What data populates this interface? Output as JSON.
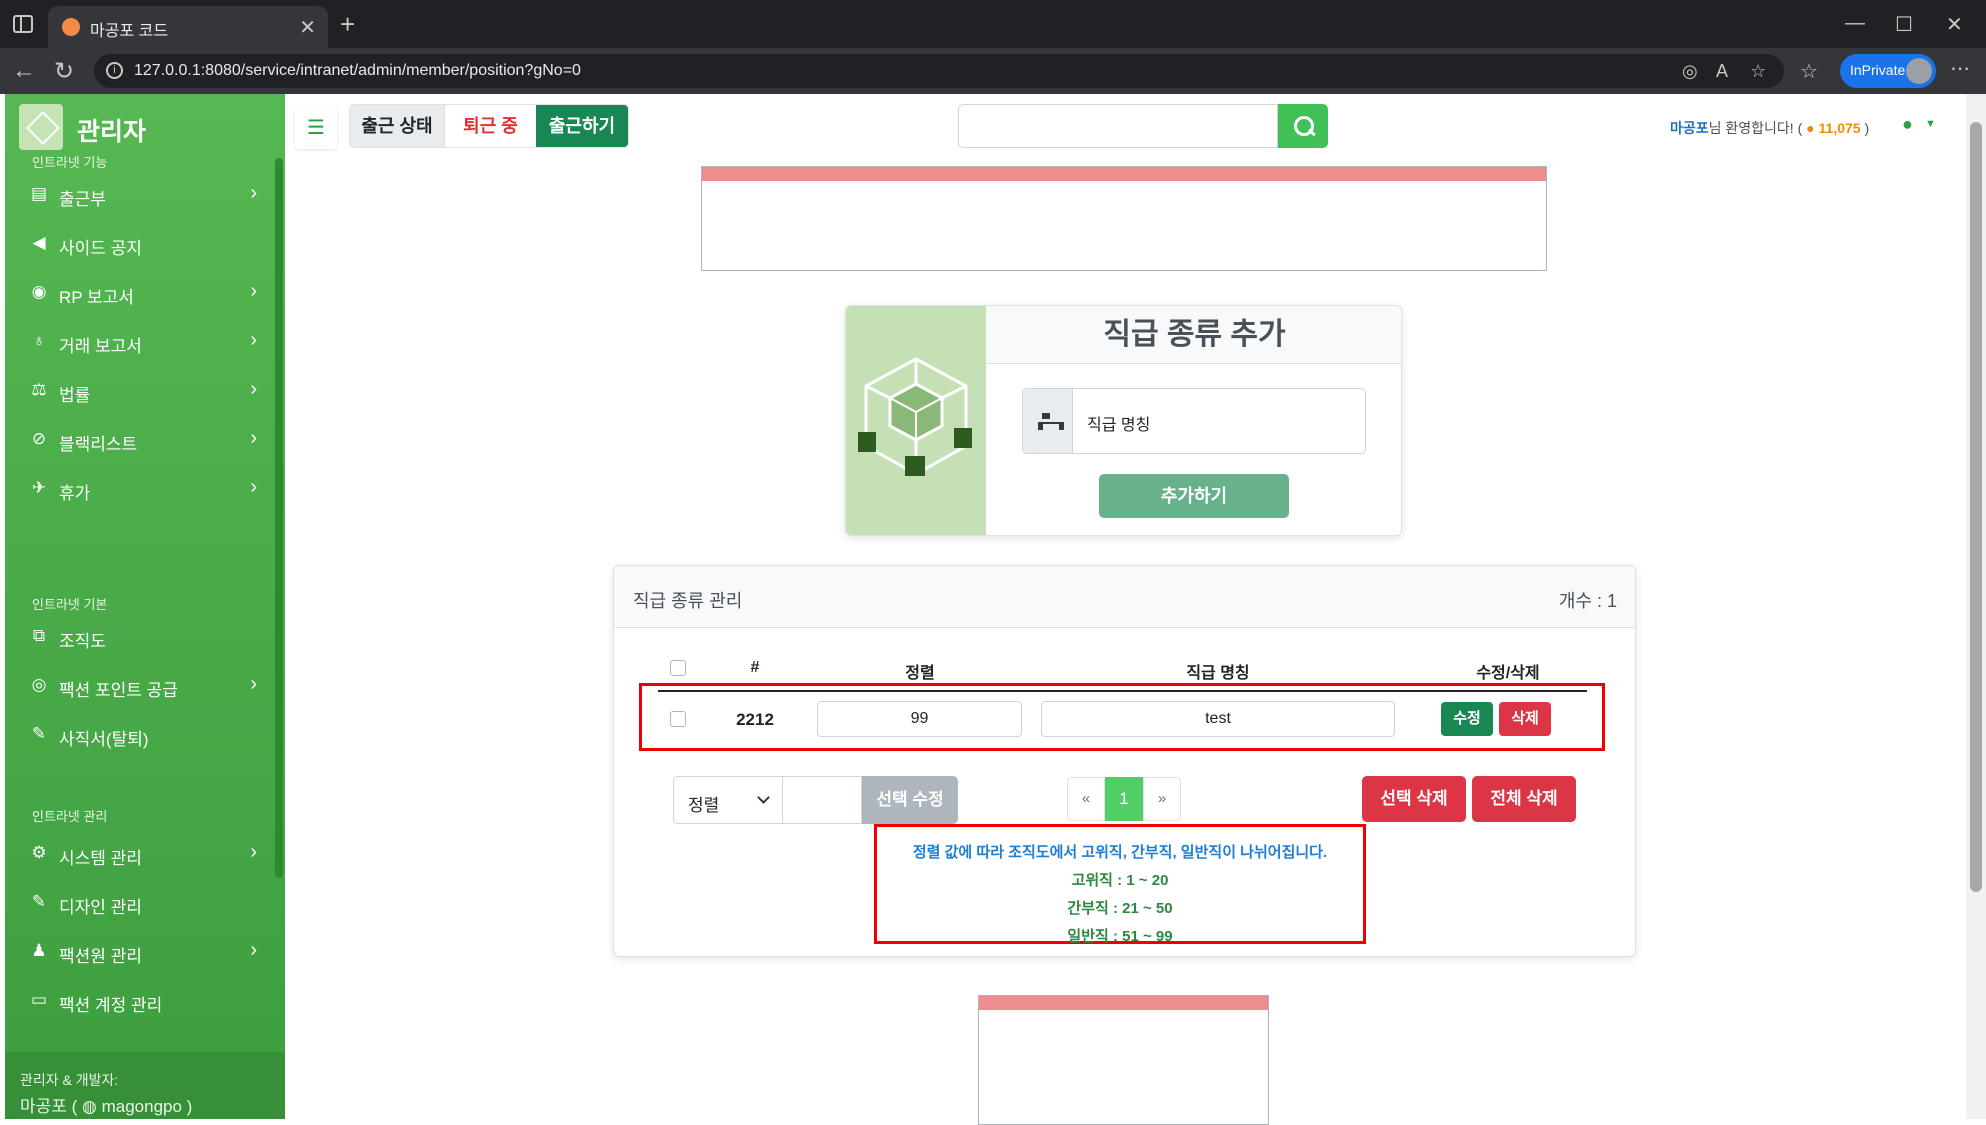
{
  "browser": {
    "tab_title": "마공포 코드",
    "url": "127.0.0.1:8080/service/intranet/admin/member/position?gNo=0",
    "inprivate_label": "InPrivate"
  },
  "sidebar": {
    "brand": "관리자",
    "sections": [
      {
        "heading": "인트라넷 기능",
        "items": [
          {
            "label": "출근부",
            "icon": "book-icon",
            "chevron": true
          },
          {
            "label": "사이드 공지",
            "icon": "megaphone-icon",
            "chevron": false
          },
          {
            "label": "RP 보고서",
            "icon": "gamepad-icon",
            "chevron": true
          },
          {
            "label": "거래 보고서",
            "icon": "money-bag-icon",
            "chevron": true
          },
          {
            "label": "법률",
            "icon": "scale-icon",
            "chevron": true
          },
          {
            "label": "블랙리스트",
            "icon": "ban-icon",
            "chevron": true
          },
          {
            "label": "휴가",
            "icon": "plane-icon",
            "chevron": true
          }
        ]
      },
      {
        "heading": "인트라넷 기본",
        "items": [
          {
            "label": "조직도",
            "icon": "sitemap-icon",
            "chevron": false
          },
          {
            "label": "팩션 포인트 공급",
            "icon": "coins-icon",
            "chevron": true
          },
          {
            "label": "사직서(탈퇴)",
            "icon": "feather-icon",
            "chevron": false
          }
        ]
      },
      {
        "heading": "인트라넷 관리",
        "items": [
          {
            "label": "시스템 관리",
            "icon": "gear-icon",
            "chevron": true
          },
          {
            "label": "디자인 관리",
            "icon": "brush-icon",
            "chevron": false
          },
          {
            "label": "팩션원 관리",
            "icon": "user-gear-icon",
            "chevron": true
          },
          {
            "label": "팩션 계정 관리",
            "icon": "id-card-icon",
            "chevron": false
          }
        ]
      }
    ],
    "footer": {
      "line1": "관리자 & 개발자:",
      "line2": "마공포 ( ",
      "handle": "magongpo",
      "close": " )"
    }
  },
  "topbar": {
    "attendance_status_label": "출근 상태",
    "attendance_off_label": "퇴근 중",
    "check_in_label": "출근하기",
    "search_placeholder": "",
    "welcome_name": "마공포",
    "welcome_text": "님 환영합니다! (",
    "coins": "11,075",
    "welcome_close": ")"
  },
  "add_card": {
    "title": "직급 종류 추가",
    "name_placeholder": "직급 명칭",
    "submit_label": "추가하기"
  },
  "management": {
    "title": "직급 종류 관리",
    "count_label": "개수 : 1",
    "columns": {
      "num": "#",
      "sort": "정렬",
      "name": "직급 명칭",
      "actions": "수정/삭제"
    },
    "rows": [
      {
        "id": "2212",
        "sort": "99",
        "name": "test",
        "edit_label": "수정",
        "delete_label": "삭제"
      }
    ],
    "sort_select_value": "정렬",
    "selected_edit_label": "선택 수정",
    "pager": [
      "«",
      "1",
      "»"
    ],
    "selected_delete_label": "선택 삭제",
    "delete_all_label": "전체 삭제"
  },
  "notice": {
    "main": "정렬 값에 따라 조직도에서 고위직, 간부직, 일반직이 나뉘어집니다.",
    "senior": "고위직 : 1 ~ 20",
    "middle": "간부직 : 21 ~ 50",
    "general": "일반직 : 51 ~ 99"
  },
  "colors": {
    "sidebar_green": "#4caf50",
    "accent_green": "#198754",
    "danger_red": "#dc3545",
    "highlight_red": "#ee0000"
  }
}
